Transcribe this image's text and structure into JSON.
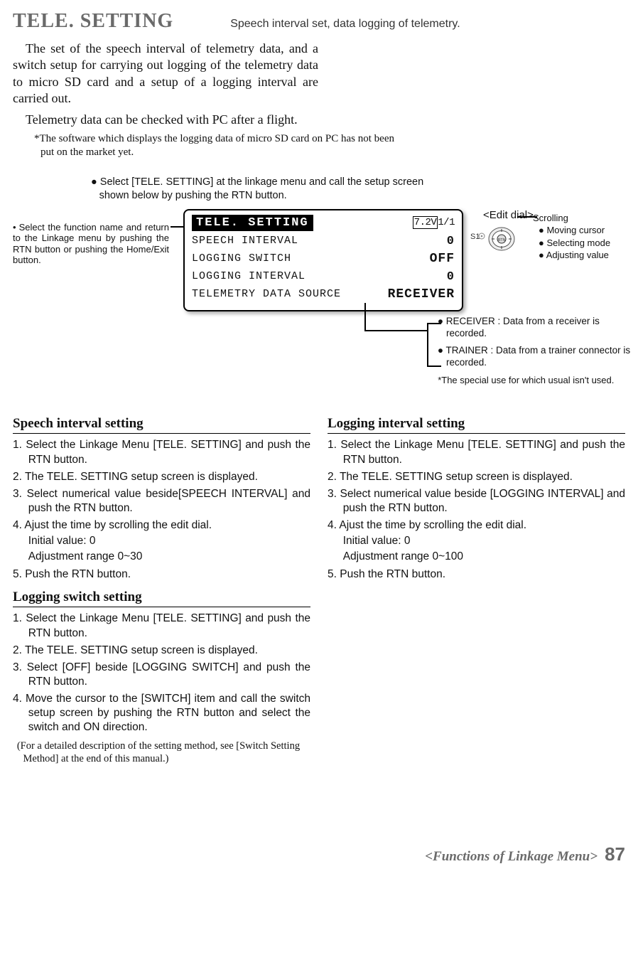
{
  "header": {
    "title": "TELE. SETTING",
    "subtitle": "Speech interval set, data logging of telemetry."
  },
  "intro": {
    "p1": "The set of the speech interval of telemetry data, and a switch setup for carrying out logging of the telemetry data to micro SD card and a setup of a logging interval are carried out.",
    "p2": "Telemetry data can be checked with PC after a flight.",
    "note": "*The software which displays the logging data of micro SD card on PC has not been put on the market yet."
  },
  "center_note": "● Select [TELE. SETTING] at the linkage menu and call the setup screen shown below by pushing the RTN button.",
  "left_callout": "Select the function name and return to the Linkage menu by pushing the RTN button or pushing the Home/Exit button.",
  "lcd": {
    "title": "TELE. SETTING",
    "battery": "7.2V",
    "page": "1/1",
    "rows": [
      {
        "label": "SPEECH INTERVAL",
        "value": "0"
      },
      {
        "label": "LOGGING SWITCH",
        "value": "OFF"
      },
      {
        "label": "LOGGING INTERVAL",
        "value": "0"
      },
      {
        "label": "TELEMETRY DATA SOURCE",
        "value": "RECEIVER"
      }
    ]
  },
  "dial": {
    "title": "<Edit dial>",
    "s1": "S1",
    "head": "Scrolling",
    "b1": "● Moving cursor",
    "b2": "● Selecting mode",
    "b3": "● Adjusting value"
  },
  "right_callouts": {
    "a": "● RECEIVER : Data from a receiver is recorded.",
    "b": "● TRAINER : Data from a trainer connector is recorded.",
    "foot": "*The special use for which usual isn't used."
  },
  "sections": {
    "speech": {
      "h": "Speech interval setting",
      "s1": "1. Select the Linkage Menu [TELE. SETTING] and push the RTN button.",
      "s2": "2. The TELE. SETTING setup screen is displayed.",
      "s3": "3. Select numerical value beside[SPEECH INTERVAL] and push the RTN button.",
      "s4": "4. Ajust the time by scrolling the edit dial.",
      "s4a": "Initial value: 0",
      "s4b": "Adjustment range 0~30",
      "s5": "5. Push the RTN button."
    },
    "logswitch": {
      "h": "Logging switch setting",
      "s1": "1. Select the Linkage Menu [TELE. SETTING] and push the RTN button.",
      "s2": "2. The TELE. SETTING setup screen is displayed.",
      "s3": "3. Select [OFF] beside [LOGGING SWITCH] and push the RTN button.",
      "s4": "4. Move the cursor to the [SWITCH] item and call the switch setup screen by pushing the RTN button and select the switch and ON direction.",
      "foot": "(For a detailed description of the setting method, see [Switch Setting Method] at the end of this manual.)"
    },
    "loginterval": {
      "h": "Logging interval setting",
      "s1": "1. Select the Linkage Menu [TELE. SETTING] and push the RTN button.",
      "s2": "2. The TELE. SETTING setup screen is displayed.",
      "s3": "3. Select numerical value beside [LOGGING INTERVAL] and push the RTN button.",
      "s4": "4. Ajust the time by scrolling the edit dial.",
      "s4a": "Initial value: 0",
      "s4b": "Adjustment range 0~100",
      "s5": "5. Push the RTN button."
    }
  },
  "footer": {
    "text": "<Functions of Linkage Menu>",
    "page": "87"
  }
}
